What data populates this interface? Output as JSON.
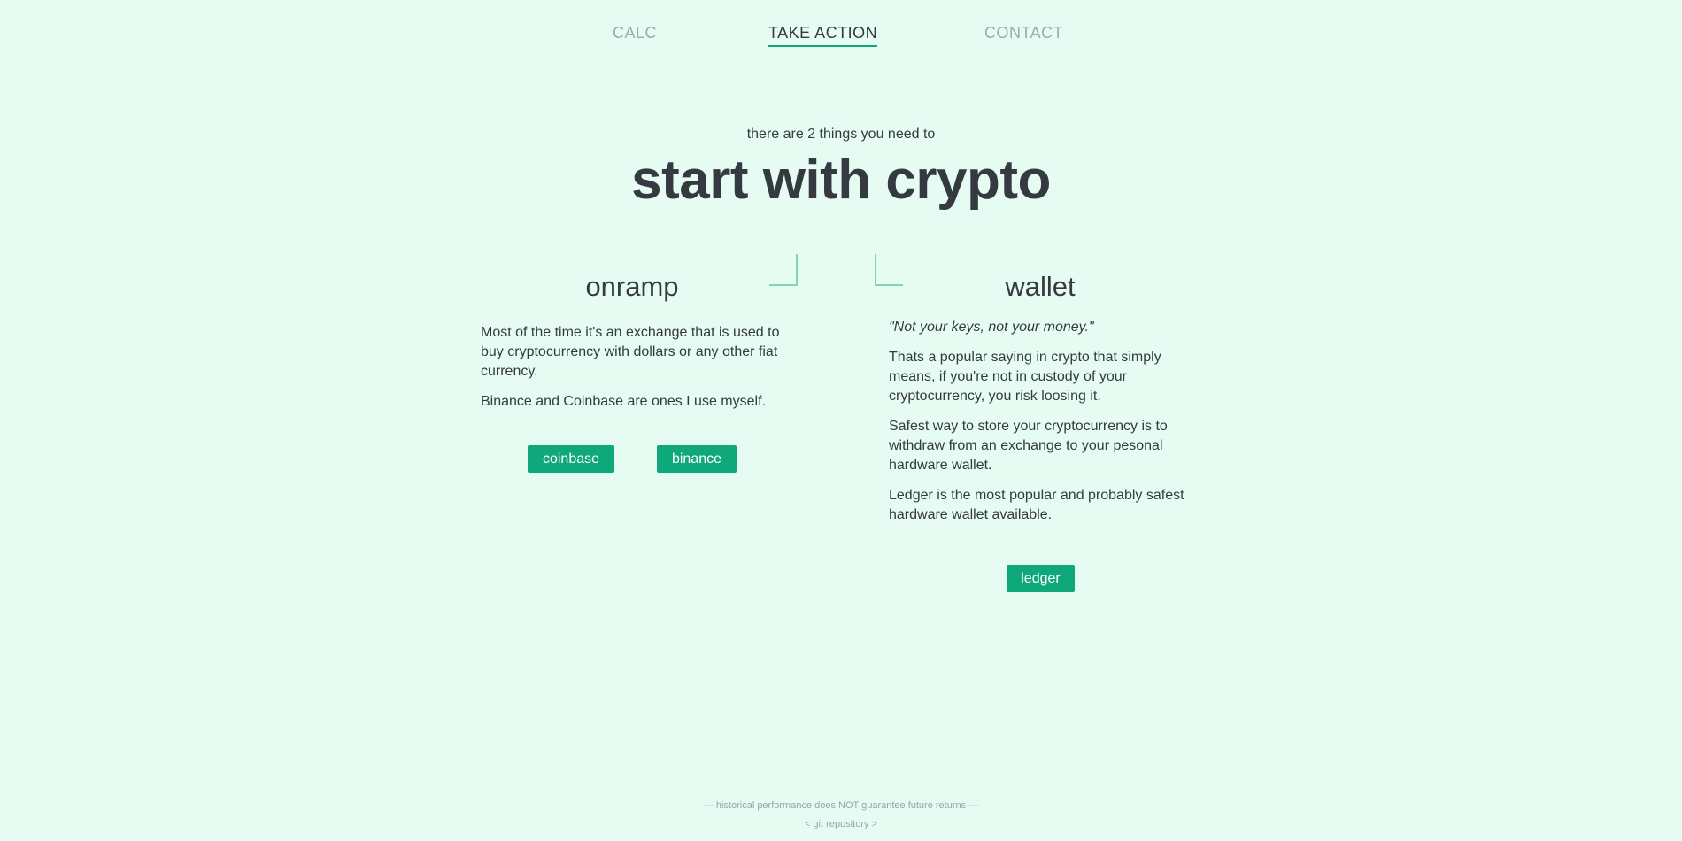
{
  "nav": {
    "items": [
      {
        "label": "CALC"
      },
      {
        "label": "TAKE ACTION",
        "active": true
      },
      {
        "label": "CONTACT"
      }
    ]
  },
  "hero": {
    "subtitle": "there are 2 things you need to",
    "title": "start with crypto"
  },
  "onramp": {
    "heading": "onramp",
    "paragraphs": [
      "Most of the time it's an exchange that is used to buy cryptocurrency with dollars or any other fiat currency.",
      "Binance and Coinbase are ones I use myself."
    ],
    "buttons": [
      "coinbase",
      "binance"
    ]
  },
  "wallet": {
    "heading": "wallet",
    "quote": "\"Not your keys, not your money.\"",
    "paragraphs": [
      "Thats a popular saying in crypto that simply means, if you're not in custody of your cryptocurrency, you risk loosing it.",
      "Safest way to store your cryptocurrency is to withdraw from an exchange to your pesonal hardware wallet.",
      "Ledger is the most popular and probably safest hardware wallet available."
    ],
    "button": "ledger"
  },
  "footer": {
    "disclaimer": "— historical performance does NOT guarantee future returns —",
    "repo_link": "< git repository >"
  },
  "colors": {
    "accent": "#0fa87a",
    "background": "#e6fcf3",
    "text": "#343a40"
  }
}
